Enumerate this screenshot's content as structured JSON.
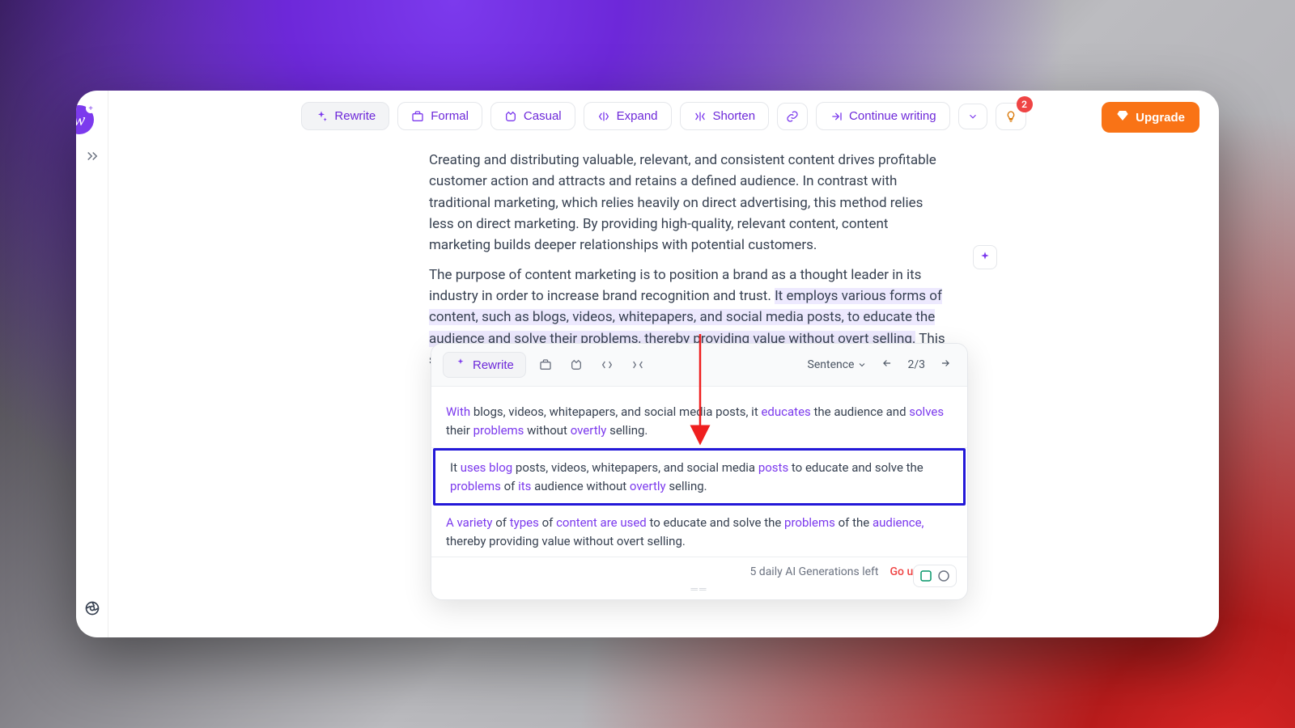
{
  "logo": {
    "letter": "w",
    "plus": "+"
  },
  "toolbar": {
    "rewrite": "Rewrite",
    "formal": "Formal",
    "casual": "Casual",
    "expand": "Expand",
    "shorten": "Shorten",
    "continue": "Continue writing"
  },
  "notifications": {
    "count": "2"
  },
  "upgrade_label": "Upgrade",
  "document": {
    "para1": "Creating and distributing valuable, relevant, and consistent content drives profitable customer action and attracts and retains a defined audience. In contrast with traditional marketing, which relies heavily on direct advertising, this method relies less on direct marketing. By providing high-quality, relevant content, content marketing builds deeper relationships with potential customers.",
    "para2_pre": "The purpose of content marketing is to position a brand as a thought leader in its industry in order to increase brand recognition and trust. ",
    "para2_hl": "It employs various forms of content, such as blogs, videos, whitepapers, and social media posts, to educate the audience and solve their problems, thereby providing value without overt selling.",
    "para2_post": " This subtle influence can"
  },
  "panel": {
    "rewrite": "Rewrite",
    "scope_label": "Sentence",
    "pager": "2/3",
    "suggestions": {
      "s1": {
        "t0": "With",
        "t1": " blogs, videos, whitepapers, and social media posts, it ",
        "t2": "educates",
        "t3": " the audience and ",
        "t4": "solves",
        "t5": " their ",
        "t6": "problems",
        "t7": " without ",
        "t8": "overtly",
        "t9": " selling."
      },
      "s2": {
        "t0": "It ",
        "t1": "uses blog",
        "t2": " posts, videos, whitepapers, and social media ",
        "t3": "posts",
        "t4": " to educate and solve the ",
        "t5": "problems",
        "t6": " of ",
        "t7": "its",
        "t8": " audience without ",
        "t9": "overtly",
        "t10": " selling."
      },
      "s3": {
        "t0": "A variety",
        "t1": " of ",
        "t2": "types",
        "t3": " of ",
        "t4": "content are used",
        "t5": " to educate and solve the ",
        "t6": "problems",
        "t7": " of the ",
        "t8": "audience,",
        "t9": " thereby providing value without overt selling."
      }
    },
    "footer": {
      "gen_left": "5 daily AI Generations left",
      "go_unlimited": "Go unlimited"
    }
  }
}
